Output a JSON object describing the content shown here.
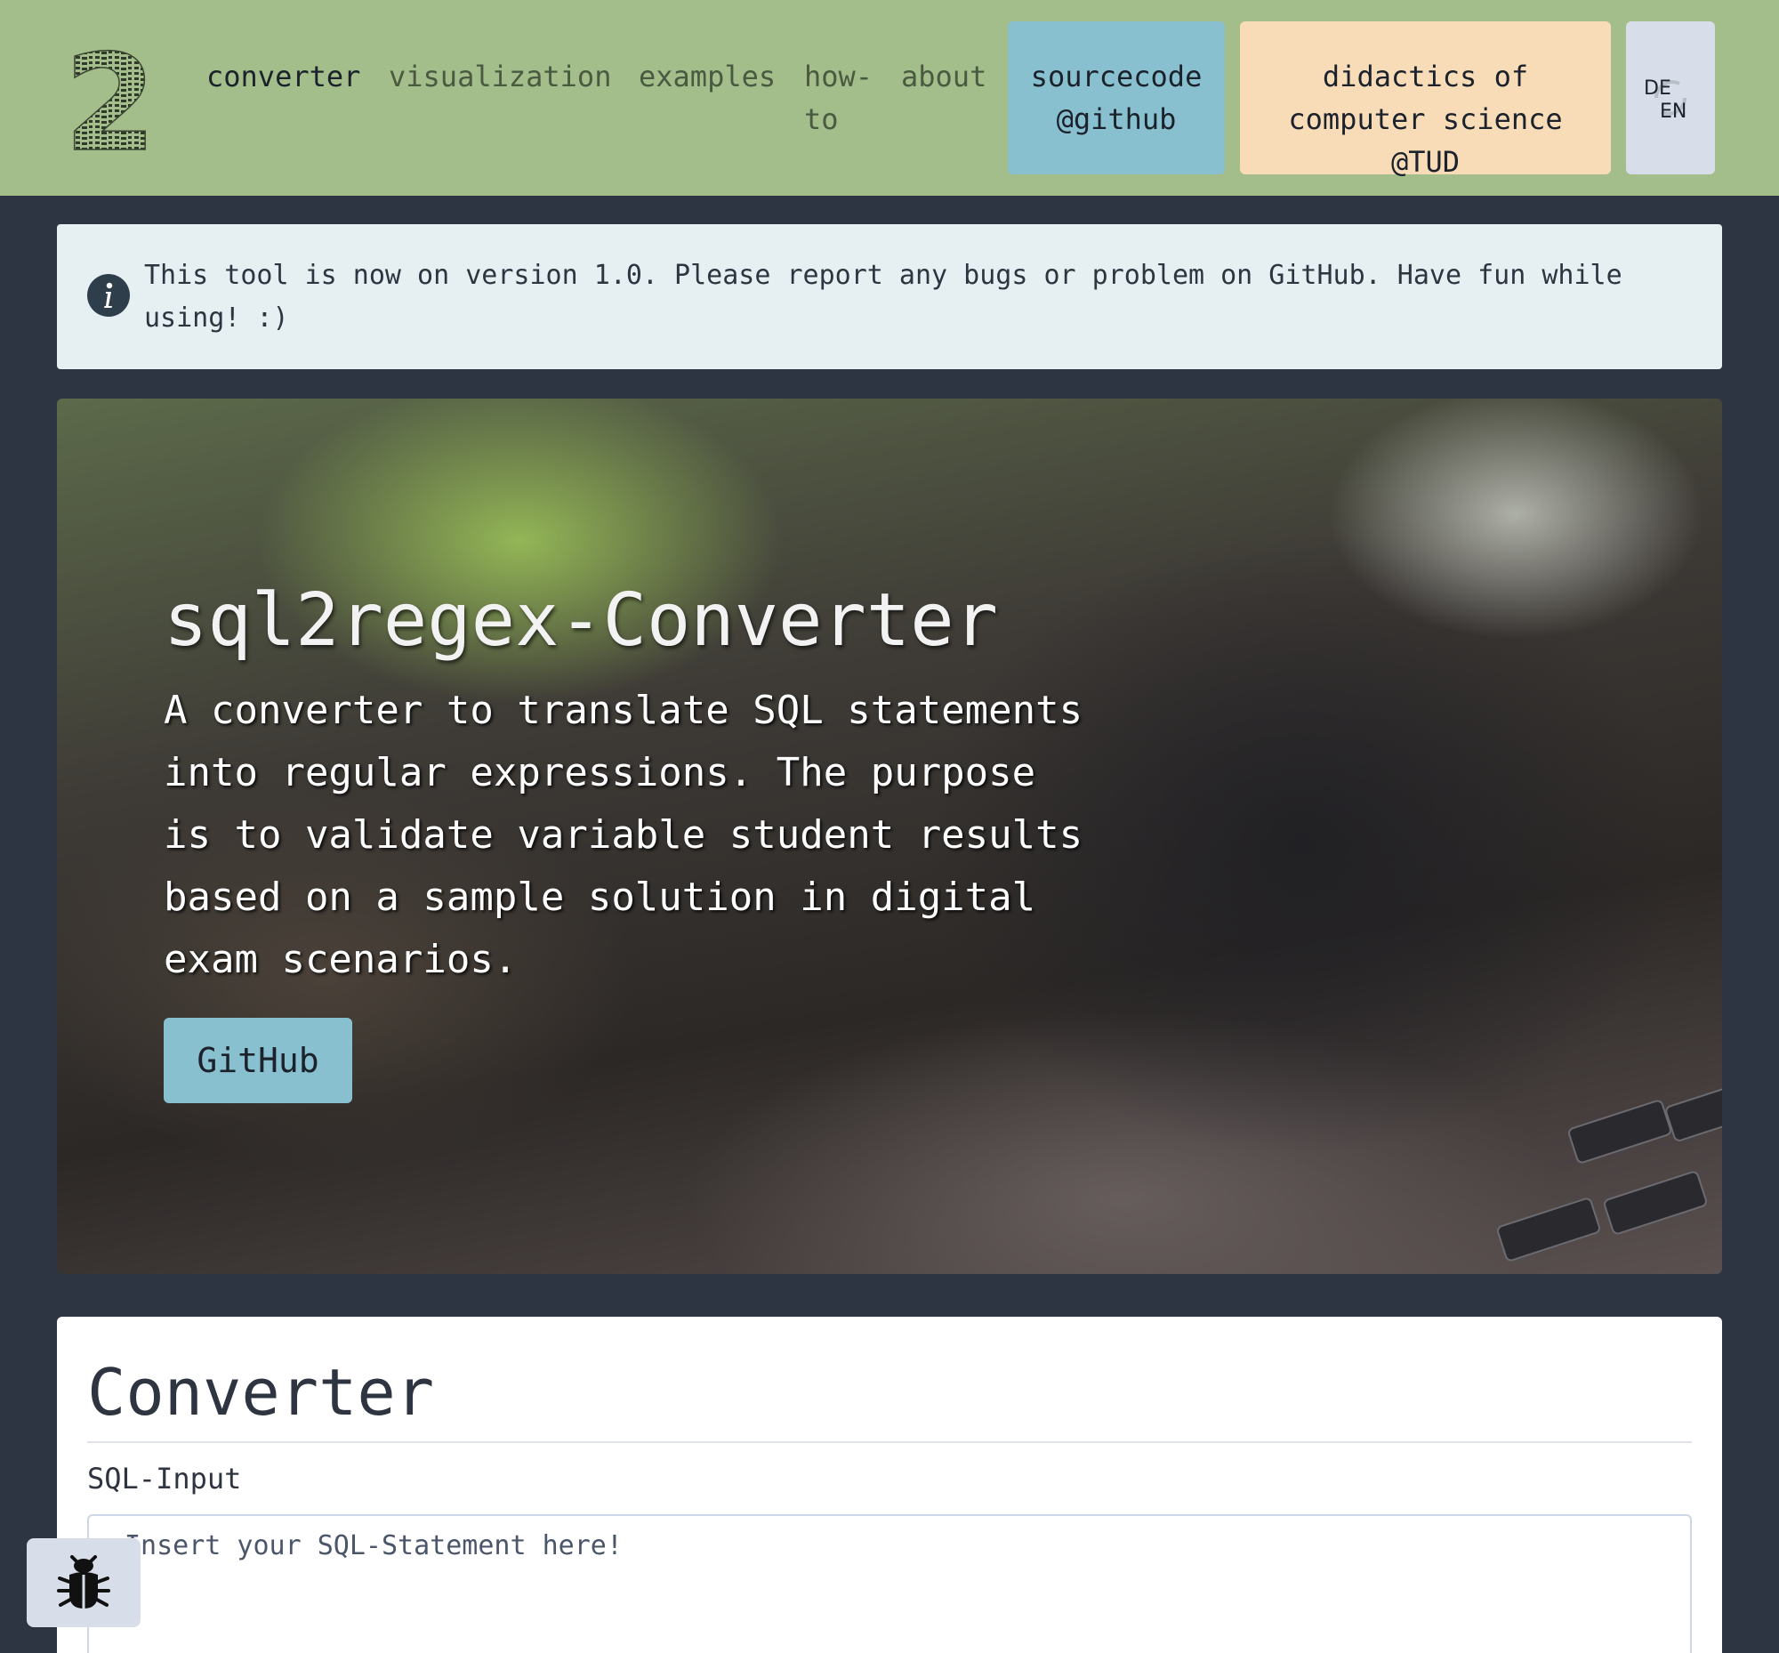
{
  "nav": {
    "logo_text": "ALTER TABLE CREATE DATABASE SQL DROP SELECT FROM WHERE INSERT UPDATE DELETE",
    "links": [
      "converter",
      "visualization",
      "examples",
      "how-to",
      "about"
    ],
    "active": "converter",
    "source_button": "sourcecode @github",
    "tud_button": "didactics of computer science @TUD",
    "lang_de": "DE",
    "lang_en": "EN"
  },
  "alert": {
    "icon": "info-icon",
    "text": "This tool is now on version 1.0. Please report any bugs or problem on GitHub. Have fun while using! :)"
  },
  "hero": {
    "title": "sql2regex-Converter",
    "description": "A converter to translate SQL statements into regular expressions. The purpose is to validate variable student results based on a sample solution in digital exam scenarios.",
    "button": "GitHub"
  },
  "converter": {
    "title": "Converter",
    "input_label": "SQL-Input",
    "input_placeholder": "Insert your SQL-Statement here!",
    "input_value": ""
  },
  "bug_button": {
    "icon": "bug-icon"
  },
  "colors": {
    "navbar": "#a3bd8b",
    "page_bg": "#2d3442",
    "source_btn": "#88c0d0",
    "tud_btn": "#f8dcb8",
    "lang_btn": "#d8dee9",
    "alert_bg": "#e6f0f3"
  }
}
